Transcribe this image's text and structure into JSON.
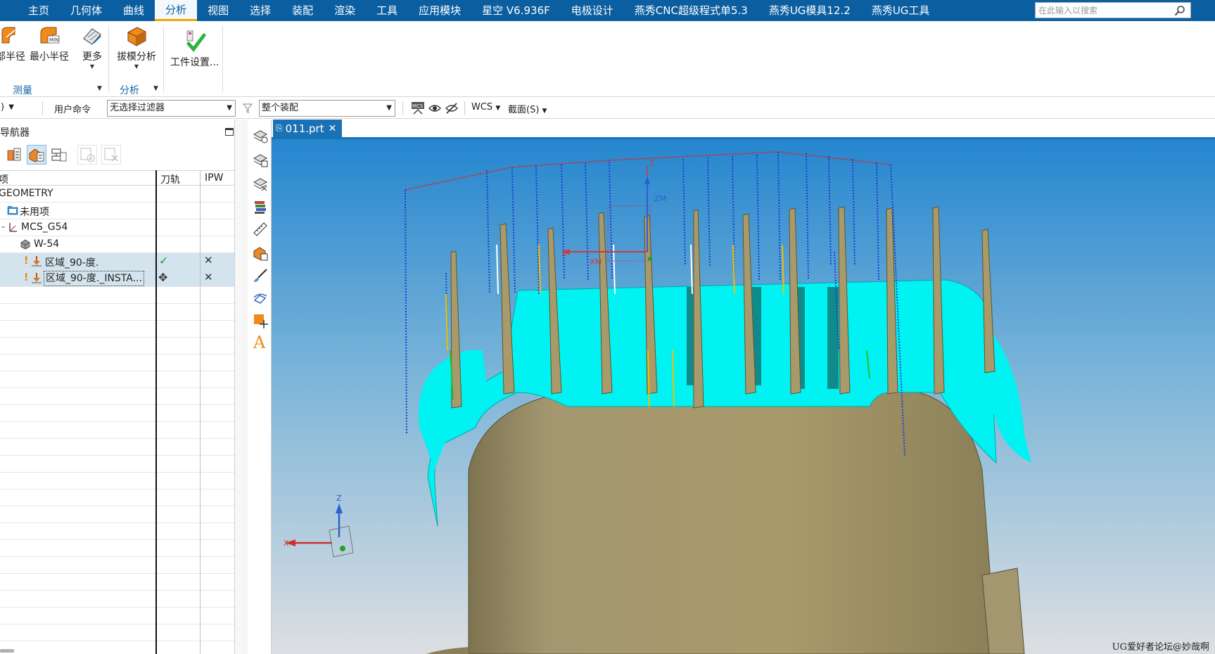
{
  "menu": {
    "items": [
      "主页",
      "几何体",
      "曲线",
      "分析",
      "视图",
      "选择",
      "装配",
      "渲染",
      "工具",
      "应用模块",
      "星空 V6.936F",
      "电极设计",
      "燕秀CNC超级程式单5.3",
      "燕秀UG模具12.2",
      "燕秀UG工具"
    ],
    "active": "分析",
    "search_placeholder": "在此输入以搜索"
  },
  "ribbon": {
    "buttons": {
      "local_radius": "部半径",
      "min_radius": "最小半径",
      "more": "更多",
      "draft_analysis": "拔模分析",
      "part_settings": "工件设置..."
    },
    "groups": {
      "measure": "测量",
      "analysis": "分析"
    }
  },
  "selection_bar": {
    "first_combo": ")",
    "user_command": "用户命令",
    "type_filter": "无选择过滤器",
    "scope": "整个装配",
    "wcs": "WCS",
    "section": "截面(S)"
  },
  "navigator": {
    "title": "导航器",
    "columns": {
      "name": "项",
      "toolpath": "刀轨",
      "ipw": "IPW"
    },
    "rows": [
      {
        "label": "GEOMETRY"
      },
      {
        "label": "未用项"
      },
      {
        "label": "MCS_G54"
      },
      {
        "label": "W-54"
      },
      {
        "label": "区域_90-度.",
        "toolpath": "✓",
        "ipw": "✕"
      },
      {
        "label": "区域_90-度._INSTA...",
        "toolpath": "✥",
        "ipw": "✕"
      }
    ]
  },
  "graphics": {
    "tab_title": "011.prt",
    "triad": {
      "z": "Z",
      "x": "X"
    },
    "wcs_labels": {
      "z": "Z",
      "zm": "ZM",
      "xm": "XM",
      "x": "X"
    },
    "watermark": "UG爱好者论坛@妙哉啊"
  },
  "colors": {
    "menubar": "#0b5fa0",
    "part": "#a89a6a",
    "cut_region": "#00ffff",
    "tool_path": "#1a3fd6",
    "viewport_top": "#2a8ad0",
    "viewport_bottom": "#d8dee2"
  }
}
